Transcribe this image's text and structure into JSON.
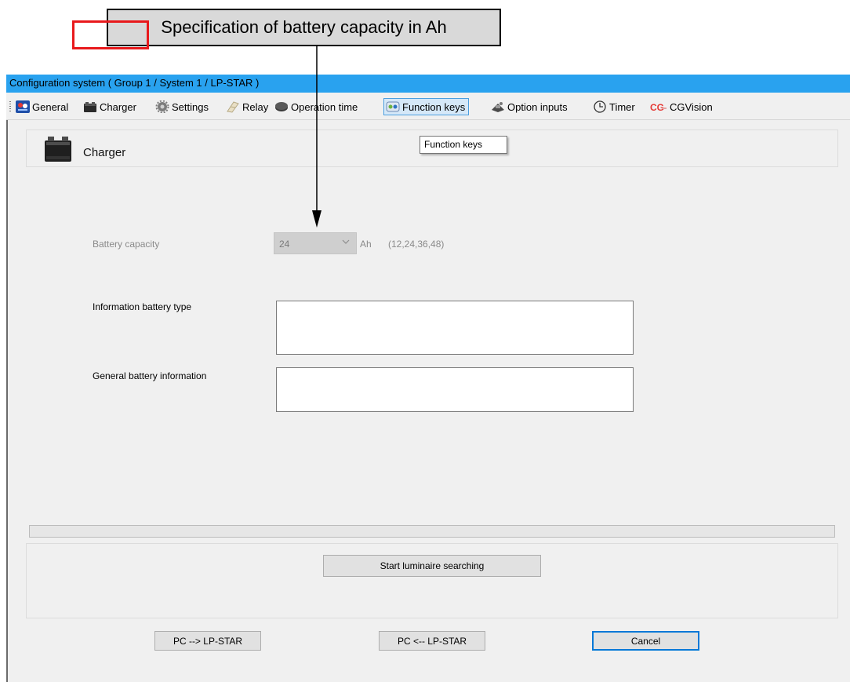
{
  "annotation": {
    "callout_text": "Specification of battery capacity in Ah"
  },
  "window": {
    "title": "Configuration system ( Group 1 / System 1 / LP-STAR )"
  },
  "toolbar": {
    "items": [
      {
        "label": "General",
        "icon": "general-icon"
      },
      {
        "label": "Charger",
        "icon": "battery-icon",
        "highlighted": true
      },
      {
        "label": "Settings",
        "icon": "gear-icon"
      },
      {
        "label": "Relay",
        "icon": "relay-icon"
      },
      {
        "label": "Operation time",
        "icon": "operation-time-icon"
      },
      {
        "label": "Function keys",
        "icon": "function-keys-icon",
        "hovered": true
      },
      {
        "label": "Option inputs",
        "icon": "option-inputs-icon"
      },
      {
        "label": "Timer",
        "icon": "clock-icon"
      },
      {
        "label": "CGVision",
        "icon": "cgvision-logo-icon"
      }
    ]
  },
  "tooltip": {
    "text": "Function keys"
  },
  "header": {
    "title": "Charger",
    "icon": "battery-icon"
  },
  "form": {
    "battery_capacity": {
      "label": "Battery capacity",
      "value": "24",
      "unit": "Ah",
      "allowed": "(12,24,36,48)",
      "enabled": false
    },
    "info_battery_type": {
      "label": "Information battery type",
      "value": ""
    },
    "general_battery_info": {
      "label": "General battery information",
      "value": ""
    }
  },
  "progress": {
    "value": 0
  },
  "buttons": {
    "search": "Start luminaire searching",
    "pc_to_device": "PC --> LP-STAR",
    "device_to_pc": "PC <-- LP-STAR",
    "cancel": "Cancel"
  },
  "colors": {
    "titlebar": "#29a2ef",
    "highlight_box": "#e8191c",
    "selected_border": "#0078d7"
  }
}
